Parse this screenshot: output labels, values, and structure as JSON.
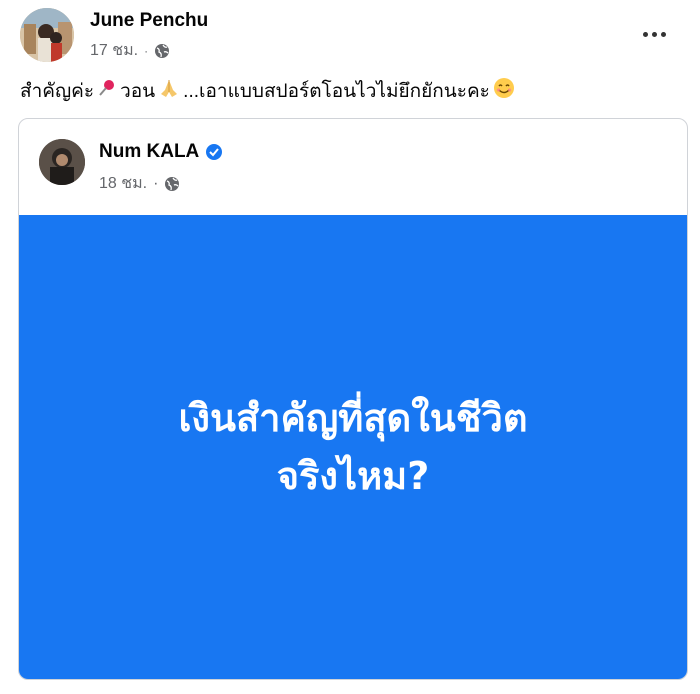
{
  "post": {
    "author": "June Penchu",
    "time": "17 ชม.",
    "separator": "·",
    "caption_part1": "สำคัญค่ะ",
    "caption_part2": "วอน",
    "caption_part3": "...เอาแบบสปอร์ตโอนไวไม่ยึกยักนะคะ",
    "icons": {
      "privacy": "globe-icon",
      "more": "more-options-icon",
      "pin": "pushpin-emoji",
      "pray": "folded-hands-emoji",
      "smile": "smiling-face-emoji"
    }
  },
  "shared_post": {
    "author": "Num KALA",
    "time": "18 ชม.",
    "separator": "·",
    "verified_icon": "verified-badge-icon",
    "card_line1": "เงินสำคัญที่สุดในชีวิต",
    "card_line2": "จริงไหม?",
    "card_color": "#1877f2"
  }
}
